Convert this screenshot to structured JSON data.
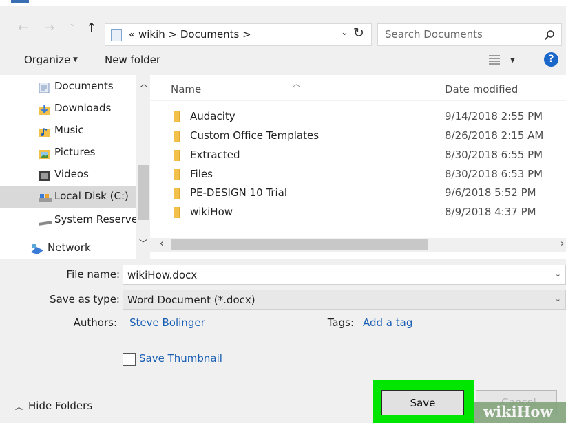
{
  "address_bar": {
    "back_glyph": "←",
    "forward_glyph": "→",
    "recent_glyph": "⌄",
    "up_glyph": "↑",
    "path": "« wikih > Documents >",
    "refresh_glyph": "↻"
  },
  "search": {
    "placeholder": "Search Documents"
  },
  "command_bar": {
    "organize_label": "Organize",
    "new_folder_label": "New folder",
    "help_label": "?"
  },
  "nav_pane": {
    "items": [
      {
        "label": "Documents",
        "icon": "documents-icon",
        "color": "#7b95bd"
      },
      {
        "label": "Downloads",
        "icon": "downloads-icon",
        "color": "#3a7bd5"
      },
      {
        "label": "Music",
        "icon": "music-icon",
        "color": "#e8a534"
      },
      {
        "label": "Pictures",
        "icon": "pictures-icon",
        "color": "#59a8d8"
      },
      {
        "label": "Videos",
        "icon": "videos-icon",
        "color": "#3d3d3d"
      },
      {
        "label": "Local Disk (C:)",
        "icon": "local-disk-icon",
        "color": "#8a8a8a",
        "selected": true
      },
      {
        "label": "System Reserved",
        "icon": "drive-icon",
        "color": "#8a8a8a"
      },
      {
        "label": "Network",
        "icon": "network-icon",
        "color": "#3a7bd5"
      }
    ]
  },
  "file_list": {
    "columns": {
      "name": "Name",
      "date_modified": "Date modified"
    },
    "rows": [
      {
        "name": "Audacity",
        "date": "9/14/2018 2:55 PM"
      },
      {
        "name": "Custom Office Templates",
        "date": "8/26/2018 2:15 AM"
      },
      {
        "name": "Extracted",
        "date": "8/30/2018 6:55 PM"
      },
      {
        "name": "Files",
        "date": "8/30/2018 6:53 PM"
      },
      {
        "name": "PE-DESIGN 10 Trial",
        "date": "9/6/2018 5:52 PM"
      },
      {
        "name": "wikiHow",
        "date": "8/9/2018 4:37 PM"
      }
    ]
  },
  "form": {
    "file_name_label": "File name:",
    "file_name_value": "wikiHow.docx",
    "save_type_label": "Save as type:",
    "save_type_value": "Word Document (*.docx)",
    "authors_label": "Authors:",
    "authors_value": "Steve Bolinger",
    "tags_label": "Tags:",
    "tags_value": "Add a tag",
    "save_thumbnail_label": "Save Thumbnail",
    "save_thumbnail_checked": false
  },
  "footer": {
    "hide_folders_label": "Hide Folders",
    "save_label": "Save",
    "cancel_label": "Cancel",
    "highlight_color": "#00e600"
  },
  "watermark": {
    "text": "wikiHow"
  }
}
